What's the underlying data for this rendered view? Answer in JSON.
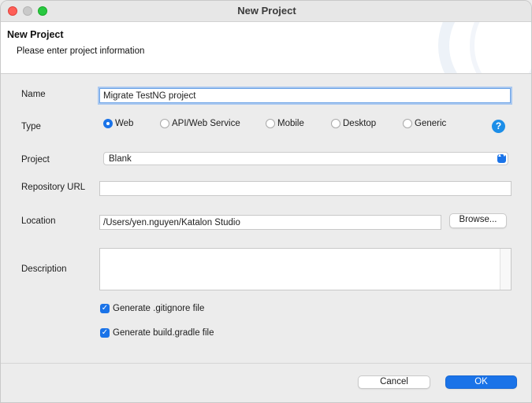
{
  "window": {
    "title": "New Project"
  },
  "header": {
    "title": "New Project",
    "subtitle": "Please enter project information"
  },
  "form": {
    "name": {
      "label": "Name",
      "value": "Migrate TestNG project"
    },
    "type": {
      "label": "Type",
      "options": [
        "Web",
        "API/Web Service",
        "Mobile",
        "Desktop",
        "Generic"
      ],
      "selected": "Web",
      "help_glyph": "?"
    },
    "project": {
      "label": "Project",
      "value": "Blank",
      "arrow_glyph": "▲▼"
    },
    "repository_url": {
      "label": "Repository URL",
      "value": ""
    },
    "location": {
      "label": "Location",
      "value": "/Users/yen.nguyen/Katalon Studio",
      "browse_label": "Browse..."
    },
    "description": {
      "label": "Description",
      "value": ""
    },
    "checkboxes": [
      {
        "label": "Generate .gitignore file",
        "checked": true
      },
      {
        "label": "Generate build.gradle file",
        "checked": true
      }
    ]
  },
  "footer": {
    "cancel_label": "Cancel",
    "ok_label": "OK"
  },
  "colors": {
    "accent": "#1a73e8",
    "close": "#fe5f57",
    "maximize": "#28c840"
  }
}
